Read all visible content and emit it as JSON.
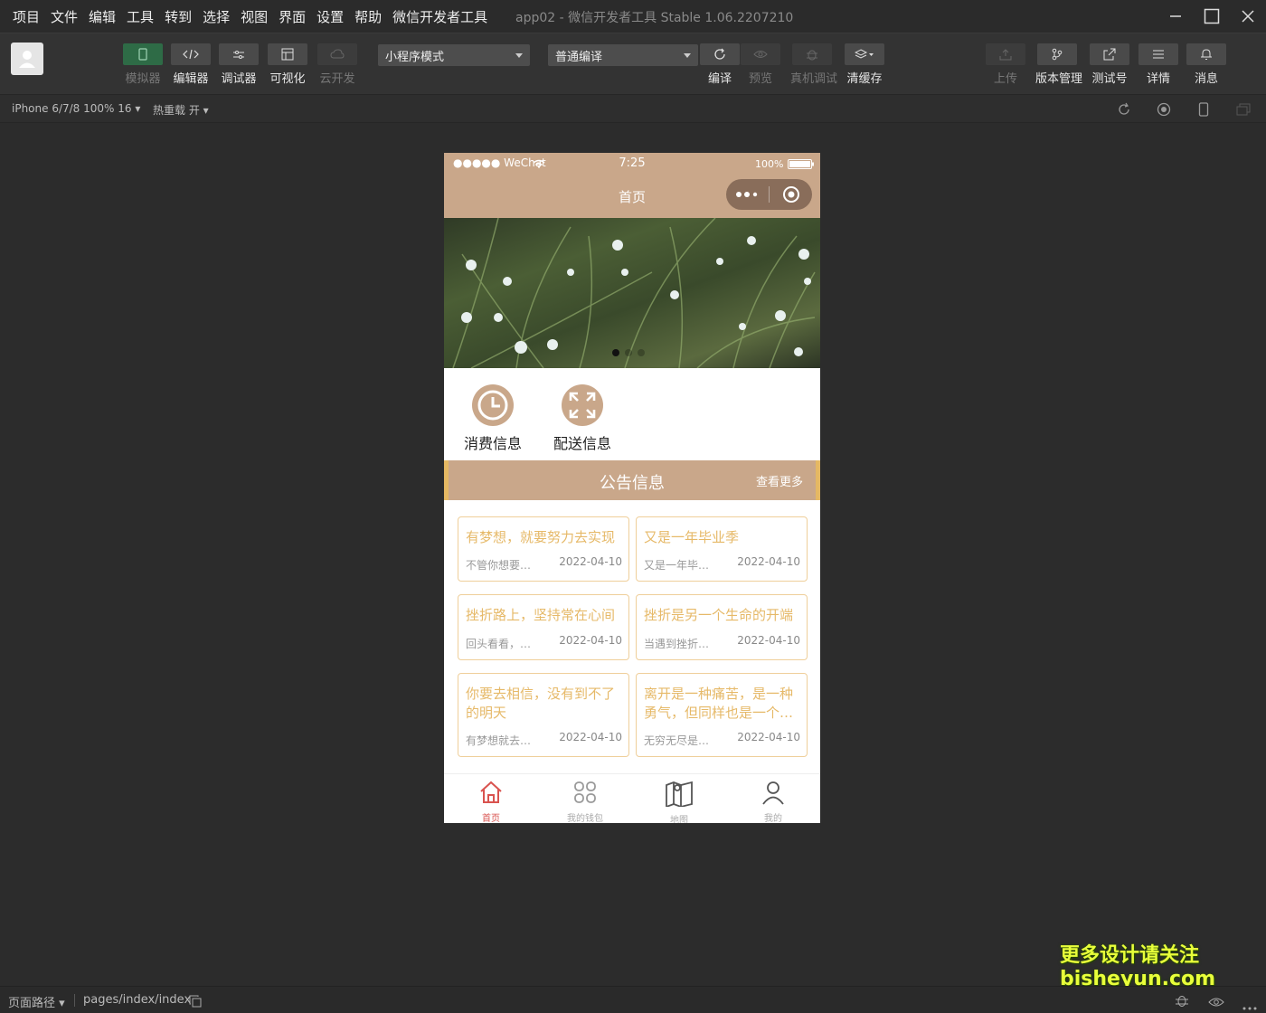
{
  "menu": [
    "项目",
    "文件",
    "编辑",
    "工具",
    "转到",
    "选择",
    "视图",
    "界面",
    "设置",
    "帮助",
    "微信开发者工具"
  ],
  "window": {
    "title": "app02 - 微信开发者工具 Stable 1.06.2207210"
  },
  "toolbar": {
    "simulator": "模拟器",
    "editor": "编辑器",
    "debugger": "调试器",
    "visual": "可视化",
    "cloud": "云开发",
    "mode": "小程序模式",
    "compile_mode": "普通编译",
    "compile": "编译",
    "preview": "预览",
    "real_debug": "真机调试",
    "clear_cache": "清缓存",
    "upload": "上传",
    "version": "版本管理",
    "test_account": "测试号",
    "details": "详情",
    "messages": "消息"
  },
  "subbar": {
    "device": "iPhone 6/7/8 100% 16 ▾",
    "hot_reload": "热重载 开 ▾"
  },
  "phone": {
    "carrier": "●●●●● WeChat",
    "time": "7:25",
    "battery": "100%",
    "nav_title": "首页",
    "quick": [
      "消费信息",
      "配送信息"
    ],
    "notice_title": "公告信息",
    "notice_more": "查看更多",
    "cards": [
      {
        "title": "有梦想，就要努力去实现",
        "summary": "不管你想要…",
        "date": "2022-04-10"
      },
      {
        "title": "又是一年毕业季",
        "summary": "又是一年毕…",
        "date": "2022-04-10"
      },
      {
        "title": "挫折路上，坚持常在心间",
        "summary": "回头看看，…",
        "date": "2022-04-10"
      },
      {
        "title": "挫折是另一个生命的开端",
        "summary": "当遇到挫折…",
        "date": "2022-04-10"
      },
      {
        "title": "你要去相信，没有到不了的明天",
        "summary": "有梦想就去…",
        "date": "2022-04-10"
      },
      {
        "title": "离开是一种痛苦，是一种勇气，但同样也是一个…",
        "summary": "无穷无尽是…",
        "date": "2022-04-10"
      }
    ],
    "tabs": [
      "首页",
      "我的钱包",
      "地图",
      "我的"
    ]
  },
  "bottom": {
    "page_path_label": "页面路径 ▾",
    "page_path": "pages/index/index"
  },
  "watermark": [
    "更多设计请关注",
    "bisheyun.com"
  ],
  "colors": {
    "theme": "#c9a78a",
    "accent": "#e5b863",
    "card_title": "#e6b968",
    "tab_active": "#d9534f"
  }
}
